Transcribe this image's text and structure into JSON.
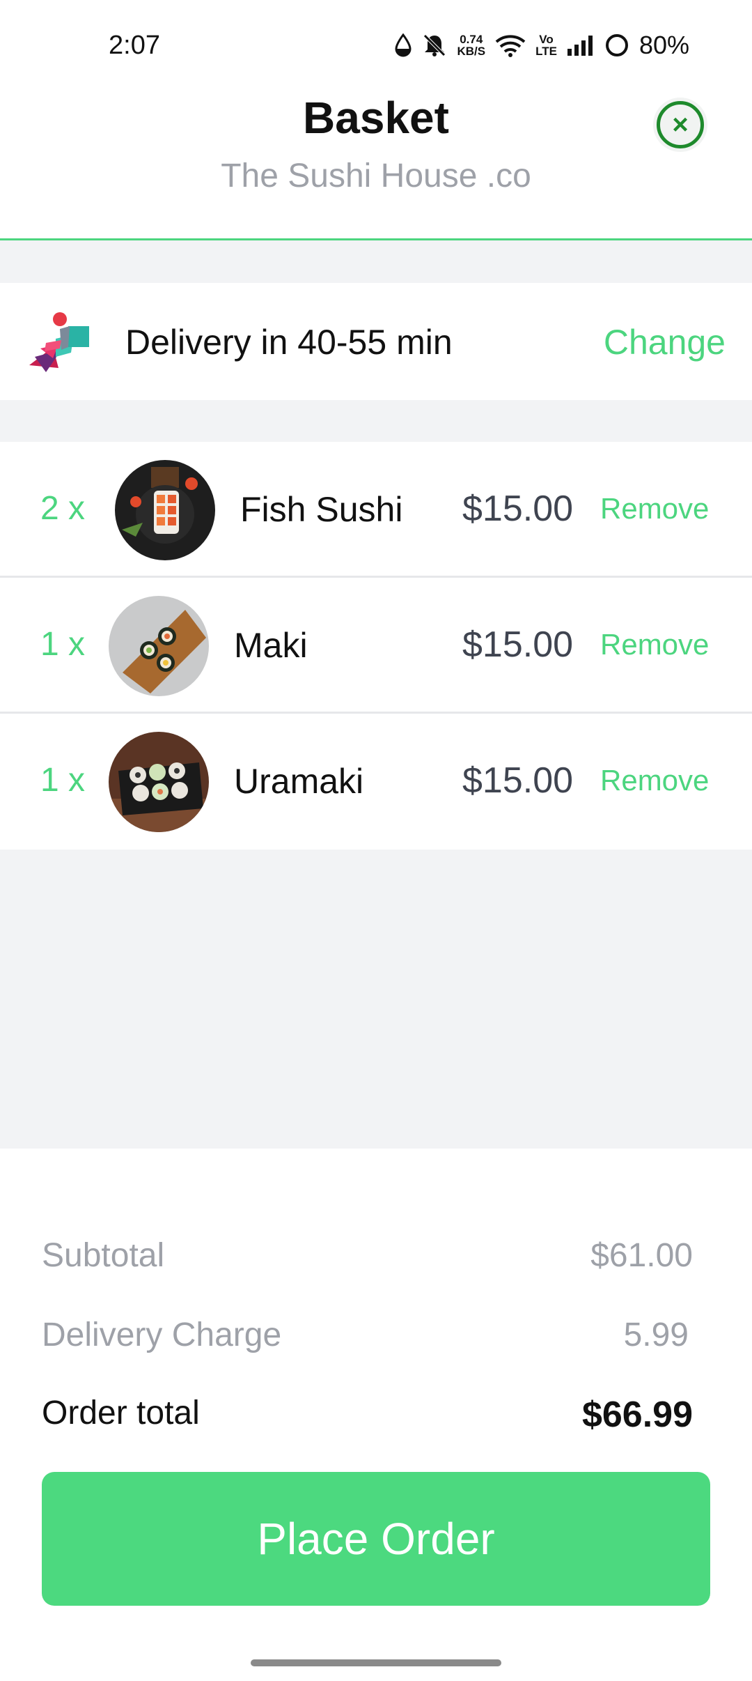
{
  "status_bar": {
    "time": "2:07",
    "net_speed_top": "0.74",
    "net_speed_bottom": "KB/S",
    "volte_top": "Vo",
    "volte_bottom": "LTE",
    "battery": "80%",
    "icons": [
      "water-drop-icon",
      "bell-off-icon",
      "wifi-icon",
      "signal-icon",
      "battery-ring-icon"
    ]
  },
  "header": {
    "title": "Basket",
    "subtitle": "The Sushi House .co",
    "close_icon": "close-icon",
    "accent": "#4cd57f",
    "close_color": "#1e8a2c"
  },
  "delivery": {
    "icon": "delivery-scooter-icon",
    "text": "Delivery in 40-55 min",
    "change_label": "Change"
  },
  "items": [
    {
      "qty": "2 x",
      "name": "Fish Sushi",
      "price": "$15.00",
      "remove_label": "Remove",
      "image": "fish-sushi-image"
    },
    {
      "qty": "1 x",
      "name": "Maki",
      "price": "$15.00",
      "remove_label": "Remove",
      "image": "maki-image"
    },
    {
      "qty": "1 x",
      "name": "Uramaki",
      "price": "$15.00",
      "remove_label": "Remove",
      "image": "uramaki-image"
    }
  ],
  "totals": {
    "subtotal_label": "Subtotal",
    "subtotal_value": "$61.00",
    "delivery_label": "Delivery Charge",
    "delivery_value": "5.99",
    "order_total_label": "Order total",
    "order_total_value": "$66.99"
  },
  "place_order_label": "Place Order",
  "colors": {
    "green": "#4cd97f",
    "gray_bg": "#f2f3f5",
    "muted_text": "#9ea1a8"
  }
}
